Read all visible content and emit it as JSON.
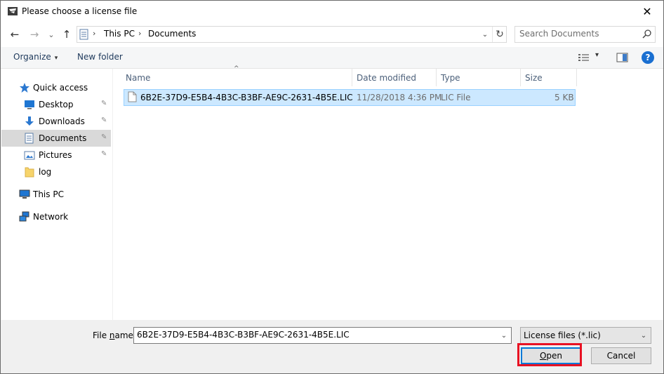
{
  "window": {
    "title": "Please choose a license file",
    "close_glyph": "✕"
  },
  "nav": {
    "back_glyph": "←",
    "forward_glyph": "→",
    "recent_glyph": "⌄",
    "up_glyph": "↑"
  },
  "address": {
    "crumbs": [
      "This PC",
      "Documents"
    ],
    "separator": "›",
    "dropdown_glyph": "⌄",
    "refresh_glyph": "↻"
  },
  "search": {
    "placeholder": "Search Documents"
  },
  "commandbar": {
    "organize_label": "Organize",
    "organize_caret": "▾",
    "new_folder_label": "New folder",
    "view_caret": "▾",
    "help_glyph": "?"
  },
  "sidebar": {
    "items": [
      {
        "label": "Quick access",
        "icon": "star-icon"
      },
      {
        "label": "Desktop",
        "icon": "desktop-icon",
        "pinned": true
      },
      {
        "label": "Downloads",
        "icon": "download-icon",
        "pinned": true
      },
      {
        "label": "Documents",
        "icon": "documents-icon",
        "pinned": true,
        "selected": true
      },
      {
        "label": "Pictures",
        "icon": "pictures-icon",
        "pinned": true
      },
      {
        "label": "log",
        "icon": "folder-icon"
      },
      {
        "label": "This PC",
        "icon": "computer-icon"
      },
      {
        "label": "Network",
        "icon": "network-icon"
      }
    ],
    "pin_glyph": "📌"
  },
  "filelist": {
    "columns": [
      "Name",
      "Date modified",
      "Type",
      "Size"
    ],
    "sort_caret": "^",
    "rows": [
      {
        "name": "6B2E-37D9-E5B4-4B3C-B3BF-AE9C-2631-4B5E.LIC",
        "date": "11/28/2018 4:36 PM",
        "type": "LIC File",
        "size": "5 KB"
      }
    ]
  },
  "footer": {
    "filename_label_pre": "File ",
    "filename_label_u": "n",
    "filename_label_post": "ame:",
    "filename_value": "6B2E-37D9-E5B4-4B3C-B3BF-AE9C-2631-4B5E.LIC",
    "filter_value": "License files (*.lic)",
    "open_u": "O",
    "open_rest": "pen",
    "cancel_label": "Cancel",
    "dropdown_glyph": "⌄"
  },
  "colors": {
    "selection_bg": "#cce8ff",
    "accent": "#0078d7",
    "highlight_box": "#e81123"
  }
}
